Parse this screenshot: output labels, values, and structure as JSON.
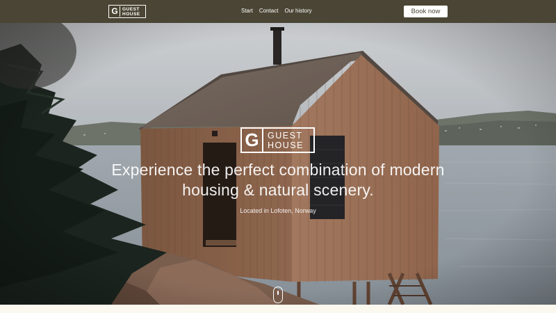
{
  "header": {
    "logo": {
      "letter": "G",
      "line1": "GUEST",
      "line2": "HOUSE"
    },
    "nav": [
      {
        "label": "Start"
      },
      {
        "label": "Contact"
      },
      {
        "label": "Our history"
      }
    ],
    "book_label": "Book now"
  },
  "hero": {
    "logo": {
      "letter": "G",
      "line1": "GUEST",
      "line2": "HOUSE"
    },
    "headline_line1": "Experience the perfect combination of modern",
    "headline_line2": "housing & natural scenery.",
    "subline": "Located in Lofoten, Norway"
  },
  "colors": {
    "header_bg": "#4a4534",
    "button_bg": "#ffffff",
    "text_light": "#ffffff",
    "page_bg": "#faf8f3"
  },
  "icons": [
    "logo-icon",
    "scroll-mouse-icon"
  ]
}
